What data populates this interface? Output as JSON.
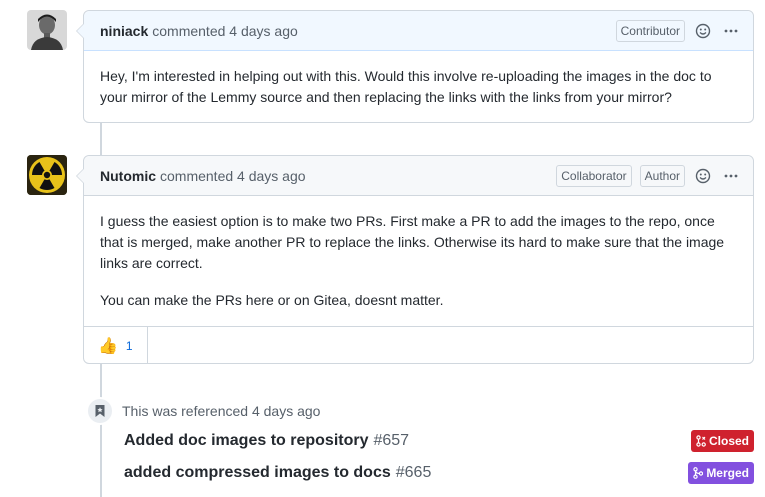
{
  "comments": [
    {
      "author": "niniack",
      "meta": "commented 4 days ago",
      "badges": [
        "Contributor"
      ],
      "body": [
        "Hey, I'm interested in helping out with this. Would this involve re-uploading the images in the doc to your mirror of the Lemmy source and then replacing the links with the links from your mirror?"
      ],
      "avatar_icon": "person-avatar"
    },
    {
      "author": "Nutomic",
      "meta": "commented 4 days ago",
      "badges": [
        "Collaborator",
        "Author"
      ],
      "body": [
        "I guess the easiest option is to make two PRs. First make a PR to add the images to the repo, once that is merged, make another PR to replace the links. Otherwise its hard to make sure that the image links are correct.",
        "You can make the PRs here or on Gitea, doesnt matter."
      ],
      "avatar_icon": "radiation-avatar",
      "reactions": [
        {
          "emoji": "👍",
          "count": "1"
        }
      ]
    }
  ],
  "reference": {
    "text": "This was referenced 4 days ago",
    "items": [
      {
        "title": "Added doc images to repository",
        "number": "#657",
        "state": "Closed",
        "state_color": "#cf222e"
      },
      {
        "title": "added compressed images to docs",
        "number": "#665",
        "state": "Merged",
        "state_color": "#8250df"
      }
    ]
  }
}
